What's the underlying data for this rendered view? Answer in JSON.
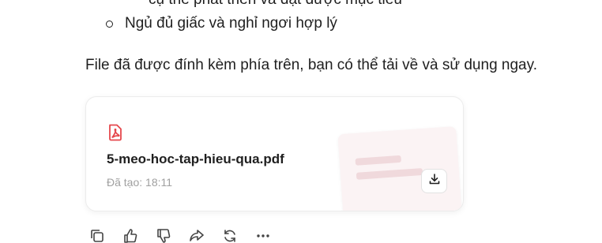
{
  "top_cutoff_text": "cụ thể phát triển và đạt được mục tiêu",
  "bullet": {
    "text": "Ngủ đủ giấc và nghỉ ngơi hợp lý"
  },
  "message": {
    "text": "File đã được đính kèm phía trên, bạn có thể tải về và sử dụng ngay."
  },
  "file_card": {
    "icon": "pdf-file-icon",
    "file_name": "5-meo-hoc-tap-hieu-qua.pdf",
    "created_label": "Đã tạo: 18:11",
    "download_icon": "download-icon",
    "accent_color": "#e5484d"
  },
  "actions": [
    {
      "icon": "copy-icon"
    },
    {
      "icon": "thumbs-up-icon"
    },
    {
      "icon": "thumbs-down-icon"
    },
    {
      "icon": "share-icon"
    },
    {
      "icon": "regenerate-icon"
    },
    {
      "icon": "more-icon"
    }
  ]
}
